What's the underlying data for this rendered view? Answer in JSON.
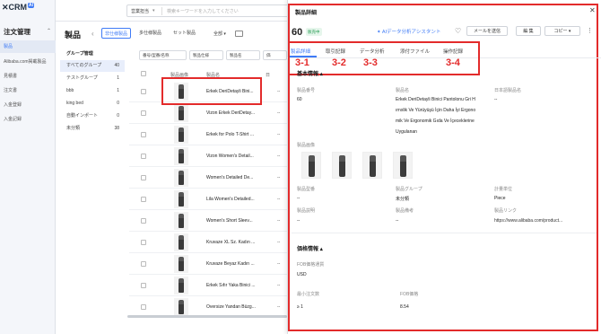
{
  "app": {
    "logo_text": "CRM",
    "logo_ai": "AI"
  },
  "nav": {
    "title": "注文管理",
    "items": [
      {
        "label": "製品",
        "active": true
      },
      {
        "label": "Alibaba.com掲載製品"
      },
      {
        "label": "見積書"
      },
      {
        "label": "注文書"
      },
      {
        "label": "入金登録"
      },
      {
        "label": "入金記録"
      }
    ]
  },
  "topbar": {
    "search_scope": "営業担当",
    "search_placeholder": "検索キーワードを入力してください"
  },
  "list": {
    "title": "製品",
    "tabs": [
      "非仕様製品",
      "多仕様製品",
      "セット製品"
    ],
    "all_label": "全部",
    "group_title": "グループ管理",
    "groups": [
      {
        "name": "すべてのグループ",
        "count": "40"
      },
      {
        "name": "テストグループ",
        "count": "1"
      },
      {
        "name": "bbb",
        "count": "1"
      },
      {
        "name": "king bed",
        "count": "0"
      },
      {
        "name": "自動インポート",
        "count": "0"
      },
      {
        "name": "未分類",
        "count": "38"
      }
    ],
    "filters": [
      "番号/型番/名称",
      "製品仕様",
      "製品名",
      "価"
    ],
    "columns": {
      "image": "製品画像",
      "name": "製品名",
      "other": "日"
    },
    "rows": [
      {
        "name": "Erkek DeriDetayli Bini..."
      },
      {
        "name": "Vizon Erkek DeriDetay..."
      },
      {
        "name": "Erkek for Polo T-Shirt ..."
      },
      {
        "name": "Vizon Women's Detail..."
      },
      {
        "name": "Women's Detailed De..."
      },
      {
        "name": "Lila Women's Detailed..."
      },
      {
        "name": "Women's Short Sleev..."
      },
      {
        "name": "Kruvaze XL Sz. Kadın ..."
      },
      {
        "name": "Kruvaze Beyaz Kadın ..."
      },
      {
        "name": "Erkek Sıfır Yaka Binici ..."
      },
      {
        "name": "Oversize Yandan Büzg..."
      }
    ],
    "dash": "--"
  },
  "panel": {
    "title": "製品詳細",
    "number": "60",
    "status": "販売中",
    "ai_assistant": "AIデータ分析アシスタント",
    "buttons": {
      "send_mail": "メールを送信",
      "edit": "編 集",
      "copy": "コピー"
    },
    "tabs": [
      "製品詳細",
      "取引記録",
      "データ分析",
      "添付ファイル",
      "操作記録"
    ],
    "annotations": [
      "3-1",
      "3-2",
      "3-3",
      "3-4"
    ],
    "basic": {
      "header": "基本情報",
      "product_no_label": "製品番号",
      "product_no": "60",
      "name_label": "製品名",
      "name_lines": [
        "Erkek DeriDetayli Binici Pantolonu Gri H",
        "ırnxlik Ve Yürüyüşü İçin Daha İyi Ergono",
        "mik Ve Ergonomik Gıda Ve İçeceklerine",
        "Uygulanan"
      ],
      "jp_name_label": "日本語製品名",
      "jp_name": "--",
      "image_label": "製品画像",
      "model_label": "製品型番",
      "model": "--",
      "group_label": "製品グループ",
      "group": "未分類",
      "unit_label": "計量単位",
      "unit": "Piece",
      "desc_label": "製品説明",
      "desc": "--",
      "note_label": "製品備考",
      "note": "--",
      "link_label": "製品リンク",
      "link": "https://www.alibaba.com/product..."
    },
    "price": {
      "header": "価格情報",
      "fob_currency_label": "FOB価格通貨",
      "fob_currency": "USD",
      "min_order_label": "最小注文数",
      "min_order": "≥ 1",
      "fob_price_label": "FOB価格",
      "fob_price": "8.54"
    }
  },
  "colors": {
    "accent": "#3f7bf6",
    "annotation": "#e32b2b"
  }
}
